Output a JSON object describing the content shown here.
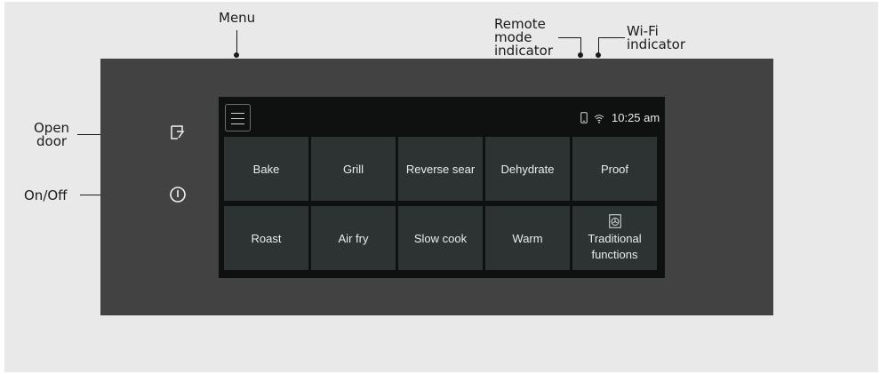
{
  "callouts": {
    "menu": "Menu",
    "remote_mode": [
      "Remote",
      "mode",
      "indicator"
    ],
    "wifi": [
      "Wi-Fi",
      "indicator"
    ],
    "open_door": [
      "Open",
      "door"
    ],
    "on_off": "On/Off"
  },
  "status_bar": {
    "time": "10:25 am",
    "icons": [
      "phone-remote-icon",
      "wifi-icon"
    ]
  },
  "functions": {
    "row1": [
      "Bake",
      "Grill",
      "Reverse sear",
      "Dehydrate",
      "Proof"
    ],
    "row2": [
      "Roast",
      "Air fry",
      "Slow cook",
      "Warm"
    ],
    "special": {
      "line1": "Traditional",
      "line2": "functions",
      "icon": "fan-oven-icon"
    }
  },
  "colors": {
    "background": "#e8e9e8",
    "panel": "#434242",
    "screen": "#0f1111",
    "tile": "#2d3233"
  }
}
